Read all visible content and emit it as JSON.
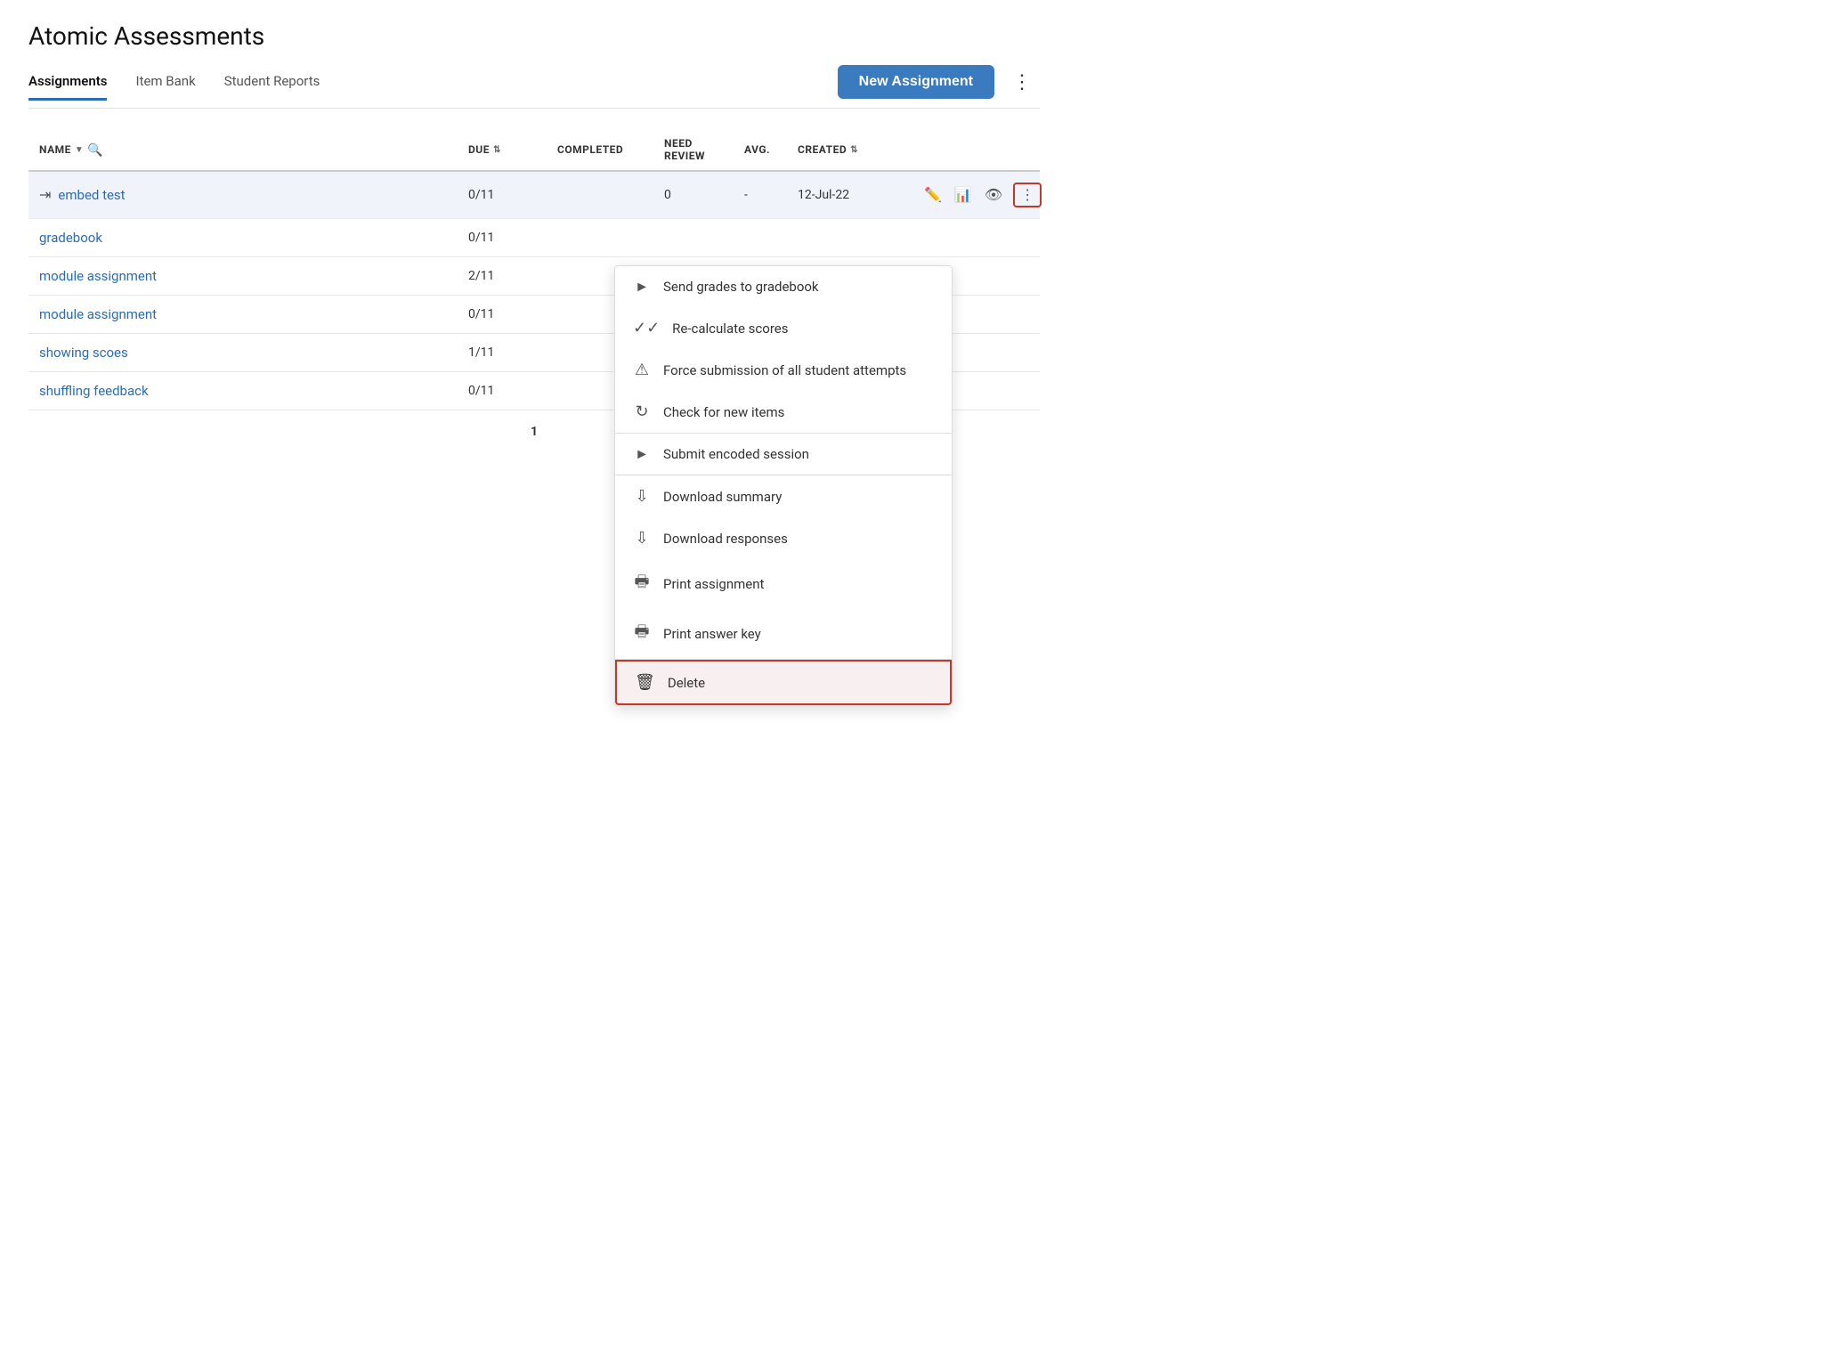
{
  "app": {
    "title": "Atomic Assessments"
  },
  "tabs": [
    {
      "label": "Assignments",
      "active": true
    },
    {
      "label": "Item Bank",
      "active": false
    },
    {
      "label": "Student Reports",
      "active": false
    }
  ],
  "toolbar": {
    "new_assignment_label": "New Assignment",
    "more_icon": "⋮"
  },
  "table": {
    "columns": [
      {
        "label": "NAME",
        "sortable": true,
        "searchable": true
      },
      {
        "label": "DUE",
        "sortable": true
      },
      {
        "label": "COMPLETED",
        "sortable": false
      },
      {
        "label": "NEED REVIEW",
        "sortable": false
      },
      {
        "label": "AVG.",
        "sortable": false
      },
      {
        "label": "CREATED",
        "sortable": true
      },
      {
        "label": "",
        "sortable": false
      }
    ],
    "rows": [
      {
        "name": "embed test",
        "embed": true,
        "due": "0/11",
        "completed": "",
        "need_review": "0",
        "avg": "-",
        "created": "12-Jul-22",
        "highlighted": true
      },
      {
        "name": "gradebook",
        "embed": false,
        "due": "0/11",
        "completed": "",
        "need_review": "",
        "avg": "",
        "created": "",
        "highlighted": false
      },
      {
        "name": "module assignment",
        "embed": false,
        "due": "2/11",
        "completed": "",
        "need_review": "",
        "avg": "",
        "created": "",
        "highlighted": false
      },
      {
        "name": "module assignment",
        "embed": false,
        "due": "0/11",
        "completed": "",
        "need_review": "",
        "avg": "",
        "created": "",
        "highlighted": false
      },
      {
        "name": "showing scoes",
        "embed": false,
        "due": "1/11",
        "completed": "",
        "need_review": "",
        "avg": "",
        "created": "",
        "highlighted": false
      },
      {
        "name": "shuffling feedback",
        "embed": false,
        "due": "0/11",
        "completed": "",
        "need_review": "",
        "avg": "",
        "created": "",
        "highlighted": false
      }
    ],
    "pagination": "1"
  },
  "dropdown_menu": {
    "items": [
      {
        "icon": "send-grades-icon",
        "label": "Send grades to gradebook",
        "divider": false,
        "group": 1
      },
      {
        "icon": "recalculate-icon",
        "label": "Re-calculate scores",
        "divider": false,
        "group": 1
      },
      {
        "icon": "force-submit-icon",
        "label": "Force submission of all student attempts",
        "divider": false,
        "group": 1
      },
      {
        "icon": "check-items-icon",
        "label": "Check for new items",
        "divider": true,
        "group": 1
      },
      {
        "icon": "submit-encoded-icon",
        "label": "Submit encoded session",
        "divider": true,
        "group": 2
      },
      {
        "icon": "download-summary-icon",
        "label": "Download summary",
        "divider": false,
        "group": 3
      },
      {
        "icon": "download-responses-icon",
        "label": "Download responses",
        "divider": false,
        "group": 3
      },
      {
        "icon": "print-assignment-icon",
        "label": "Print assignment",
        "divider": false,
        "group": 3
      },
      {
        "icon": "print-answer-key-icon",
        "label": "Print answer key",
        "divider": true,
        "group": 3
      },
      {
        "icon": "delete-icon",
        "label": "Delete",
        "divider": false,
        "group": 4,
        "delete": true
      }
    ]
  },
  "colors": {
    "accent_blue": "#2a6db5",
    "button_blue": "#3a7abf",
    "delete_red": "#c0392b",
    "highlight_bg": "#f0f4fa"
  }
}
